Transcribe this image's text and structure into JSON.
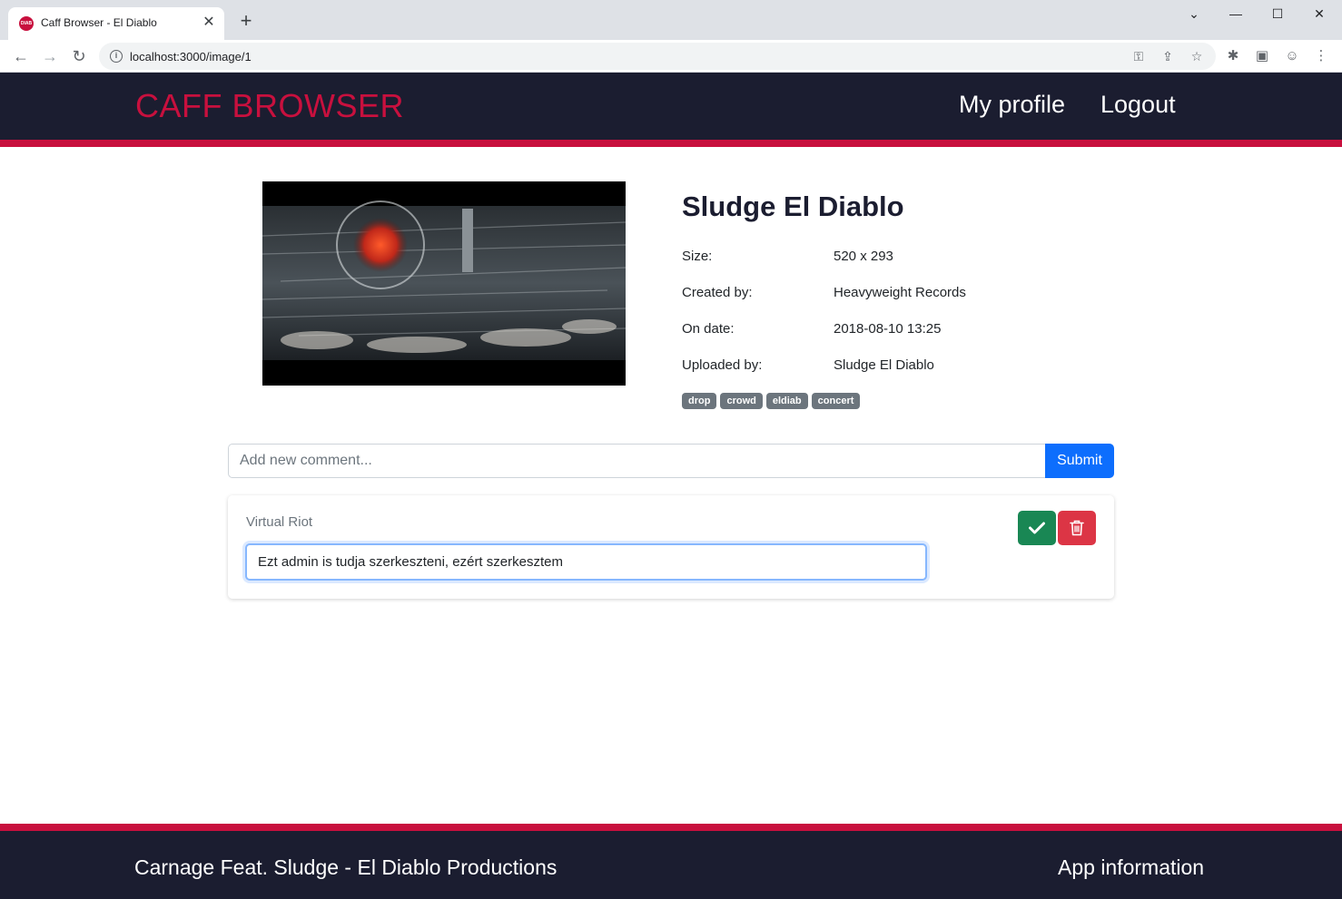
{
  "browser": {
    "tab_title": "Caff Browser - El Diablo",
    "favicon_text": "DIAB",
    "url": "localhost:3000/image/1"
  },
  "header": {
    "brand": "CAFF BROWSER",
    "nav": [
      "My profile",
      "Logout"
    ]
  },
  "image": {
    "title": "Sludge El Diablo",
    "meta": [
      {
        "label": "Size:",
        "value": "520 x 293"
      },
      {
        "label": "Created by:",
        "value": "Heavyweight Records"
      },
      {
        "label": "On date:",
        "value": "2018-08-10 13:25"
      },
      {
        "label": "Uploaded by:",
        "value": "Sludge El Diablo"
      }
    ],
    "tags": [
      "drop",
      "crowd",
      "eldiab",
      "concert"
    ]
  },
  "comment_form": {
    "placeholder": "Add new comment...",
    "submit_label": "Submit"
  },
  "comments": [
    {
      "author": "Virtual Riot",
      "text": "Ezt admin is tudja szerkeszteni, ezért szerkesztem"
    }
  ],
  "footer": {
    "left": "Carnage Feat. Sludge - El Diablo Productions",
    "right": "App information"
  },
  "colors": {
    "brand": "#c8103e",
    "header_bg": "#1b1d30",
    "primary": "#0d6efd",
    "success": "#198754",
    "danger": "#dc3545",
    "tag_bg": "#6c757d"
  }
}
